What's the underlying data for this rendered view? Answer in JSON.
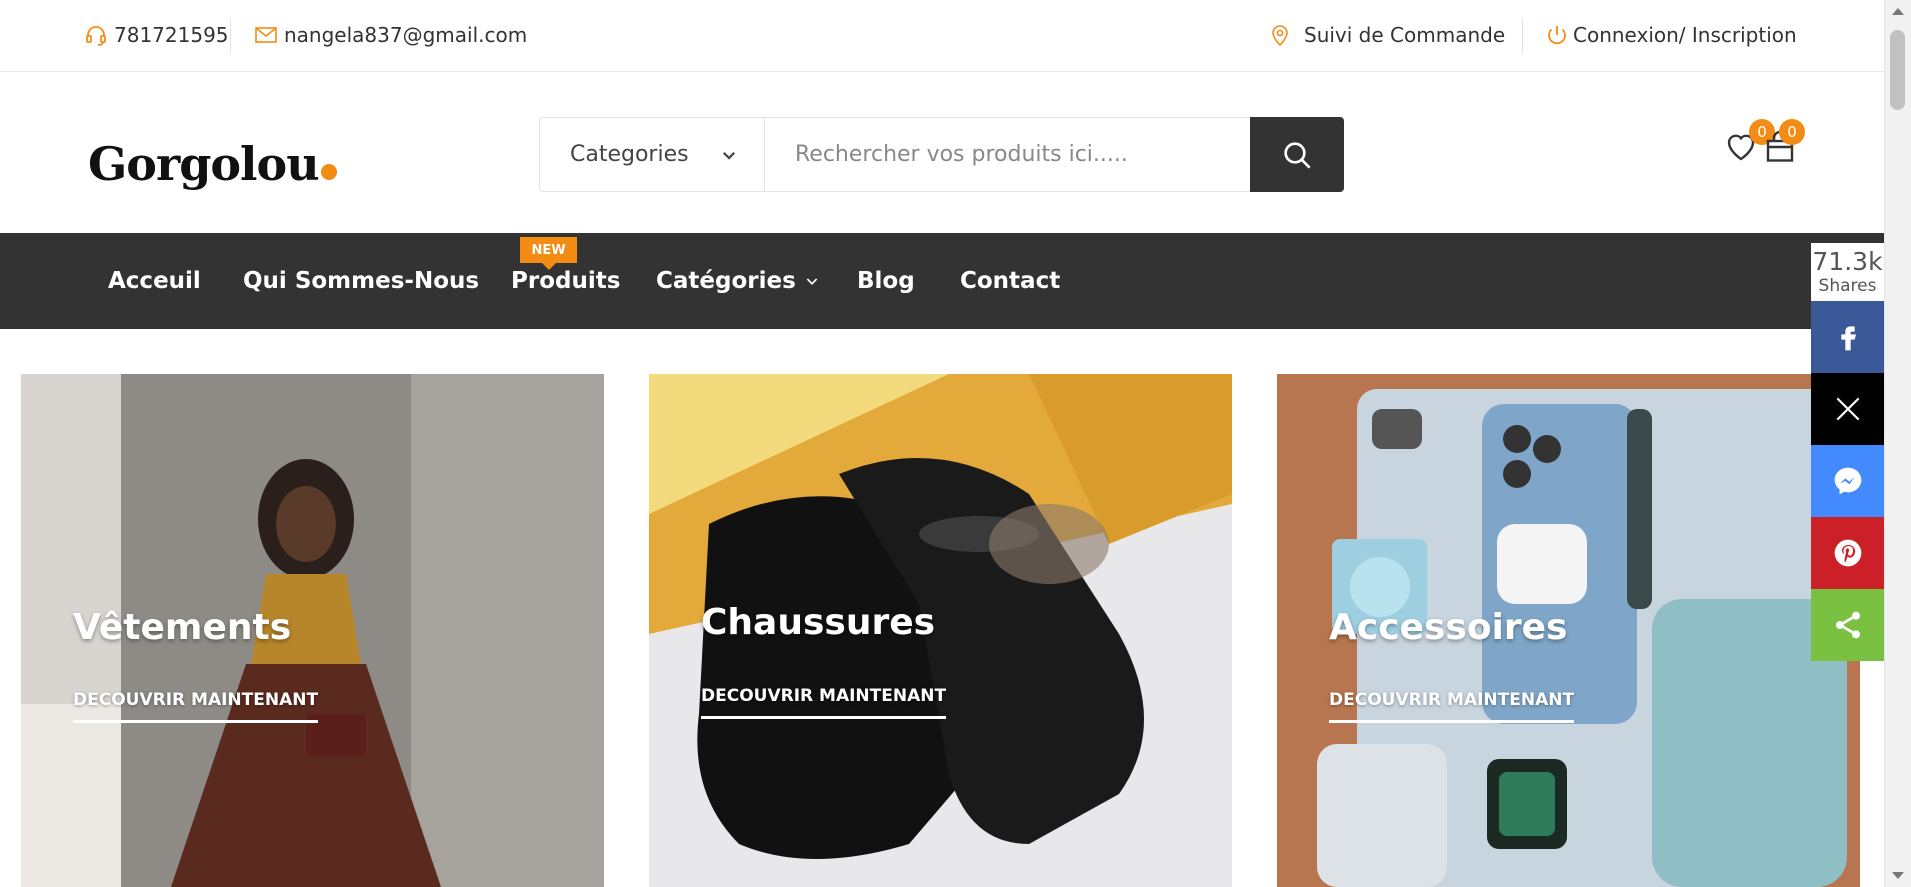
{
  "topbar": {
    "phone": "781721595",
    "email": "nangela837@gmail.com",
    "tracking": "Suivi de Commande",
    "login": "Connexion/ Inscription"
  },
  "header": {
    "logo": "Gorgolou",
    "search": {
      "category_label": "Categories",
      "placeholder": "Rechercher vos produits ici....."
    },
    "wishlist_count": "0",
    "cart_count": "0"
  },
  "nav": {
    "items": [
      "Acceuil",
      "Qui Sommes-Nous",
      "Produits",
      "Catégories",
      "Blog",
      "Contact"
    ],
    "new_badge": "NEW"
  },
  "categories": [
    {
      "title": "Vêtements",
      "cta": "DECOUVRIR MAINTENANT"
    },
    {
      "title": "Chaussures",
      "cta": "DECOUVRIR MAINTENANT"
    },
    {
      "title": "Accessoires",
      "cta": "DECOUVRIR MAINTENANT"
    }
  ],
  "share": {
    "count": "71.3k",
    "label": "Shares"
  },
  "colors": {
    "accent": "#f28c14",
    "dark": "#333333",
    "facebook": "#3b5998",
    "twitter": "#000000",
    "messenger": "#448aff",
    "pinterest": "#cb2027",
    "sharethis": "#7ac142"
  }
}
